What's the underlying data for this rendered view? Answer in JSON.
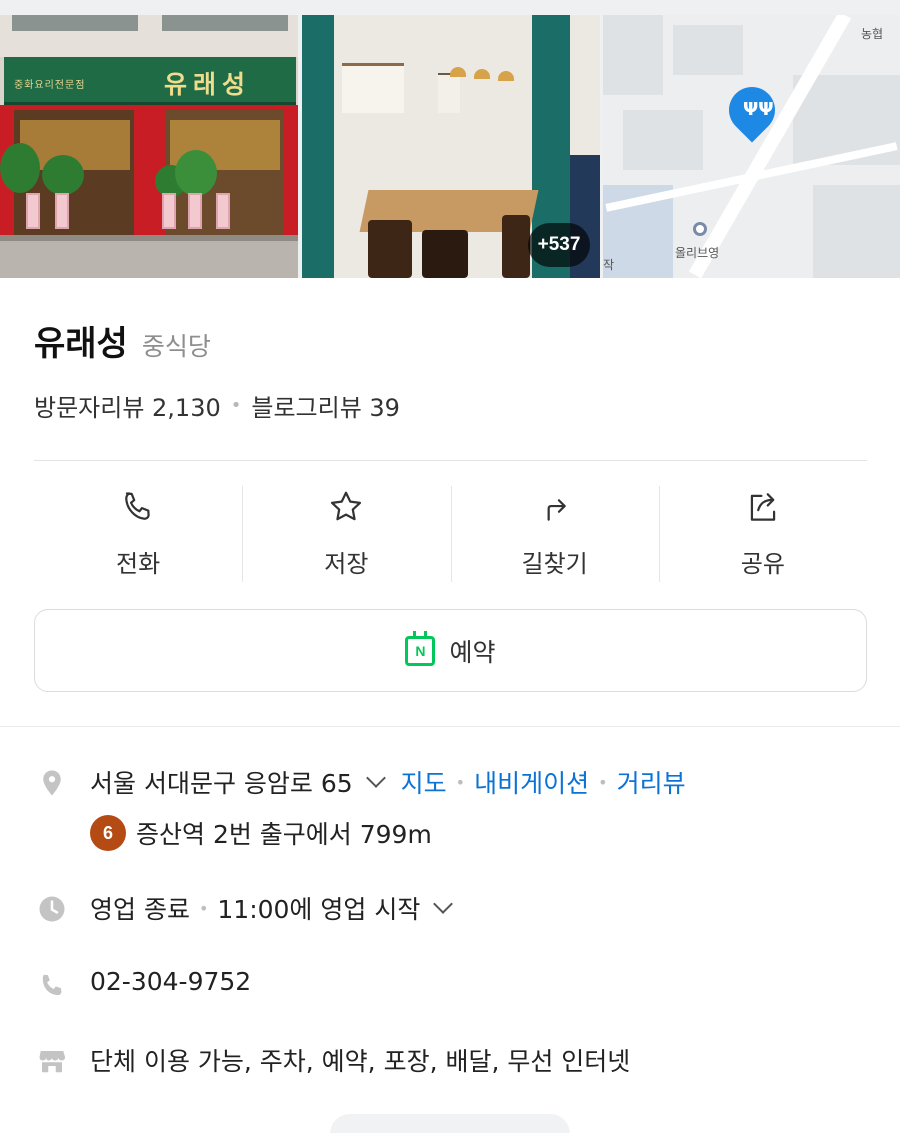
{
  "photos": {
    "storefront": {
      "sign_name": "유래성",
      "sign_subtitle": "중화요리전문점"
    },
    "more_count": "+537",
    "map": {
      "label_bank": "농협",
      "label_station": "올리브영",
      "label_corner": "작"
    }
  },
  "place": {
    "name": "유래성",
    "category": "중식당",
    "visitor_reviews": "방문자리뷰 2,130",
    "blog_reviews": "블로그리뷰 39"
  },
  "actions": [
    {
      "label": "전화",
      "icon": "phone-icon"
    },
    {
      "label": "저장",
      "icon": "star-icon"
    },
    {
      "label": "길찾기",
      "icon": "directions-icon"
    },
    {
      "label": "공유",
      "icon": "share-icon"
    }
  ],
  "reserve": {
    "icon_letter": "N",
    "label": "예약"
  },
  "info": {
    "address": "서울 서대문구 응암로 65",
    "links": [
      "지도",
      "내비게이션",
      "거리뷰"
    ],
    "subway_line": "6",
    "subway_text": "증산역 2번 출구에서 799m",
    "hours_status": "영업 종료",
    "hours_next": "11:00에 영업 시작",
    "phone": "02-304-9752",
    "amenities": "단체 이용 가능, 주차, 예약, 포장, 배달, 무선 인터넷"
  },
  "colors": {
    "link": "#0c72d4",
    "naver_green": "#03c75a",
    "subway_line6": "#b44b14",
    "map_pin": "#1e88e5"
  }
}
